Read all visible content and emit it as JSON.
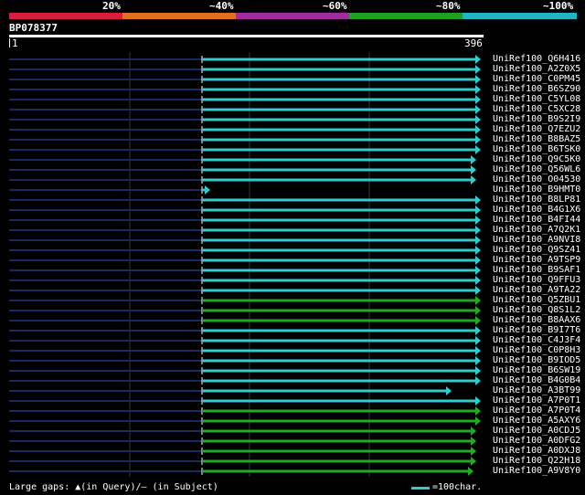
{
  "legend": {
    "labels": [
      "20%",
      "~40%",
      "~60%",
      "~80%",
      "~100%"
    ],
    "colors": [
      "#dc1c3c",
      "#e07020",
      "#a02ca0",
      "#20a020",
      "#20b4c4"
    ]
  },
  "query": {
    "name": "BP078377",
    "start": "1",
    "end": "396"
  },
  "hits": [
    {
      "label": "UniRef100_Q6H416",
      "color": "#3cc"
    },
    {
      "label": "UniRef100_A2Z0X5",
      "color": "#3cc"
    },
    {
      "label": "UniRef100_C0PM45",
      "color": "#3cc"
    },
    {
      "label": "UniRef100_B6SZ90",
      "color": "#3cc"
    },
    {
      "label": "UniRef100_C5YL08",
      "color": "#3cc"
    },
    {
      "label": "UniRef100_C5XC28",
      "color": "#3cc"
    },
    {
      "label": "UniRef100_B9S2I9",
      "color": "#3cc"
    },
    {
      "label": "UniRef100_Q7EZU2",
      "color": "#3cc"
    },
    {
      "label": "UniRef100_B8BAZ5",
      "color": "#3cc"
    },
    {
      "label": "UniRef100_B6TSK0",
      "color": "#3cc"
    },
    {
      "label": "UniRef100_Q9C5K0",
      "color": "#3cc"
    },
    {
      "label": "UniRef100_Q56WL6",
      "color": "#3cc"
    },
    {
      "label": "UniRef100_O04530",
      "color": "#3cc"
    },
    {
      "label": "UniRef100_B9HMT0",
      "color": "#3cc"
    },
    {
      "label": "UniRef100_B8LP81",
      "color": "#3cc"
    },
    {
      "label": "UniRef100_B4G1X6",
      "color": "#3cc"
    },
    {
      "label": "UniRef100_B4FI44",
      "color": "#3cc"
    },
    {
      "label": "UniRef100_A7Q2K1",
      "color": "#3cc"
    },
    {
      "label": "UniRef100_A9NVI8",
      "color": "#3cc"
    },
    {
      "label": "UniRef100_Q9SZ41",
      "color": "#3cc"
    },
    {
      "label": "UniRef100_A9TSP9",
      "color": "#3cc"
    },
    {
      "label": "UniRef100_B9SAF1",
      "color": "#3cc"
    },
    {
      "label": "UniRef100_Q9FFU3",
      "color": "#3cc"
    },
    {
      "label": "UniRef100_A9TA22",
      "color": "#3cc"
    },
    {
      "label": "UniRef100_Q5ZBU1",
      "color": "#2a2"
    },
    {
      "label": "UniRef100_Q8S1L2",
      "color": "#2a2"
    },
    {
      "label": "UniRef100_B8AAX6",
      "color": "#2a2"
    },
    {
      "label": "UniRef100_B9I7T6",
      "color": "#3cc"
    },
    {
      "label": "UniRef100_C4J3F4",
      "color": "#3cc"
    },
    {
      "label": "UniRef100_C0P8H3",
      "color": "#3cc"
    },
    {
      "label": "UniRef100_B9IOD5",
      "color": "#3cc"
    },
    {
      "label": "UniRef100_B6SW19",
      "color": "#3cc"
    },
    {
      "label": "UniRef100_B4G0B4",
      "color": "#3cc"
    },
    {
      "label": "UniRef100_A3BT99",
      "color": "#3cc"
    },
    {
      "label": "UniRef100_A7P0T1",
      "color": "#3cc"
    },
    {
      "label": "UniRef100_A7P0T4",
      "color": "#2a2"
    },
    {
      "label": "UniRef100_A5AXY6",
      "color": "#2a2"
    },
    {
      "label": "UniRef100_A0CDJ5",
      "color": "#2a2"
    },
    {
      "label": "UniRef100_A0DFG2",
      "color": "#2a2"
    },
    {
      "label": "UniRef100_A0DXJ8",
      "color": "#2a2"
    },
    {
      "label": "UniRef100_Q22H18",
      "color": "#2a2"
    },
    {
      "label": "UniRef100_A9V8Y0",
      "color": "#2a2"
    }
  ],
  "footer": {
    "gaps_text": "Large gaps: ▲(in Query)/– (in Subject)",
    "scale_text": "=100char."
  }
}
